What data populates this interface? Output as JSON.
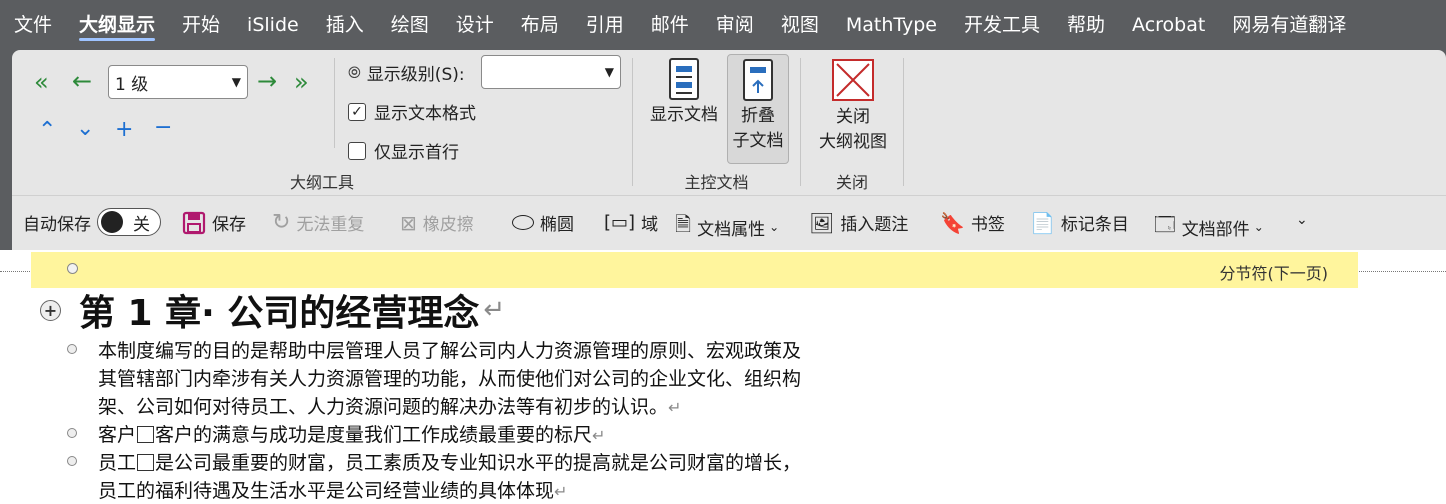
{
  "menu": {
    "tabs": [
      "文件",
      "大纲显示",
      "开始",
      "iSlide",
      "插入",
      "绘图",
      "设计",
      "布局",
      "引用",
      "邮件",
      "审阅",
      "视图",
      "MathType",
      "开发工具",
      "帮助",
      "Acrobat",
      "网易有道翻译"
    ],
    "active_tab": "大纲显示"
  },
  "ribbon": {
    "outline_tools": {
      "label": "大纲工具",
      "level_select_value": "1 级",
      "show_level_label": "显示级别(S):",
      "show_level_value": "",
      "show_text_format_label": "显示文本格式",
      "show_text_format_checked": true,
      "show_first_line_label": "仅显示首行",
      "show_first_line_checked": false
    },
    "master_document": {
      "label": "主控文档",
      "show_document_label": "显示文档",
      "collapse_line1": "折叠",
      "collapse_line2": "子文档"
    },
    "close": {
      "label": "关闭",
      "close_line1": "关闭",
      "close_line2": "大纲视图"
    }
  },
  "qat": {
    "autosave_label": "自动保存",
    "autosave_state": "关",
    "save": "保存",
    "redo": "无法重复",
    "eraser": "橡皮擦",
    "ellipse": "椭圆",
    "field": "域",
    "doc_properties": "文档属性",
    "insert_caption": "插入题注",
    "bookmark": "书签",
    "mark_entry": "标记条目",
    "doc_parts": "文档部件"
  },
  "document": {
    "section_break": "分节符(下一页)",
    "heading": "第 1 章· 公司的经营理念",
    "paragraphs": [
      {
        "lines": [
          "本制度编写的目的是帮助中层管理人员了解公司内人力资源管理的原则、宏观政策及",
          "其管辖部门内牵涉有关人力资源管理的功能，从而使他们对公司的企业文化、组织构",
          "架、公司如何对待员工、人力资源问题的解决办法等有初步的认识。"
        ]
      },
      {
        "lead": "客户",
        "rest": "客户的满意与成功是度量我们工作成绩最重要的标尺"
      },
      {
        "lead": "员工",
        "rest": "是公司最重要的财富，员工素质及专业知识水平的提高就是公司财富的增长，",
        "line2": "员工的福利待遇及生活水平是公司经营业绩的具体体现"
      }
    ]
  },
  "colors": {
    "titlebar": "#5b5d60",
    "ribbon": "#e6e6e6",
    "arrow_green": "#2d8a3a",
    "arrow_blue": "#1d6fd1",
    "section_highlight": "#fff59d",
    "save_icon": "#b0196e"
  }
}
